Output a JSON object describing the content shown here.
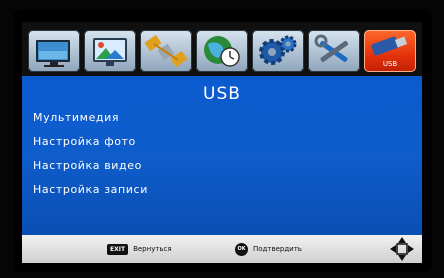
{
  "tabs": [
    {
      "icon": "tv-icon",
      "label": ""
    },
    {
      "icon": "monitor-picture-icon",
      "label": ""
    },
    {
      "icon": "satellite-icon",
      "label": ""
    },
    {
      "icon": "globe-clock-icon",
      "label": ""
    },
    {
      "icon": "gears-icon",
      "label": ""
    },
    {
      "icon": "tools-icon",
      "label": ""
    },
    {
      "icon": "usb-drive-icon",
      "label": "USB"
    }
  ],
  "active_tab_index": 6,
  "panel": {
    "title": "USB",
    "items": [
      "Мультимедия",
      "Настройка фото",
      "Настройка видео",
      "Настройка записи"
    ]
  },
  "footer": {
    "back_key": "EXIT",
    "back_label": "Вернуться",
    "confirm_key": "OK",
    "confirm_label": "Подтвердить",
    "nav_icon": "dpad-arrows-icon"
  },
  "colors": {
    "panel_blue": "#0b5bd0",
    "active_tab": "#e3330c",
    "footer": "#dcdcdc"
  }
}
